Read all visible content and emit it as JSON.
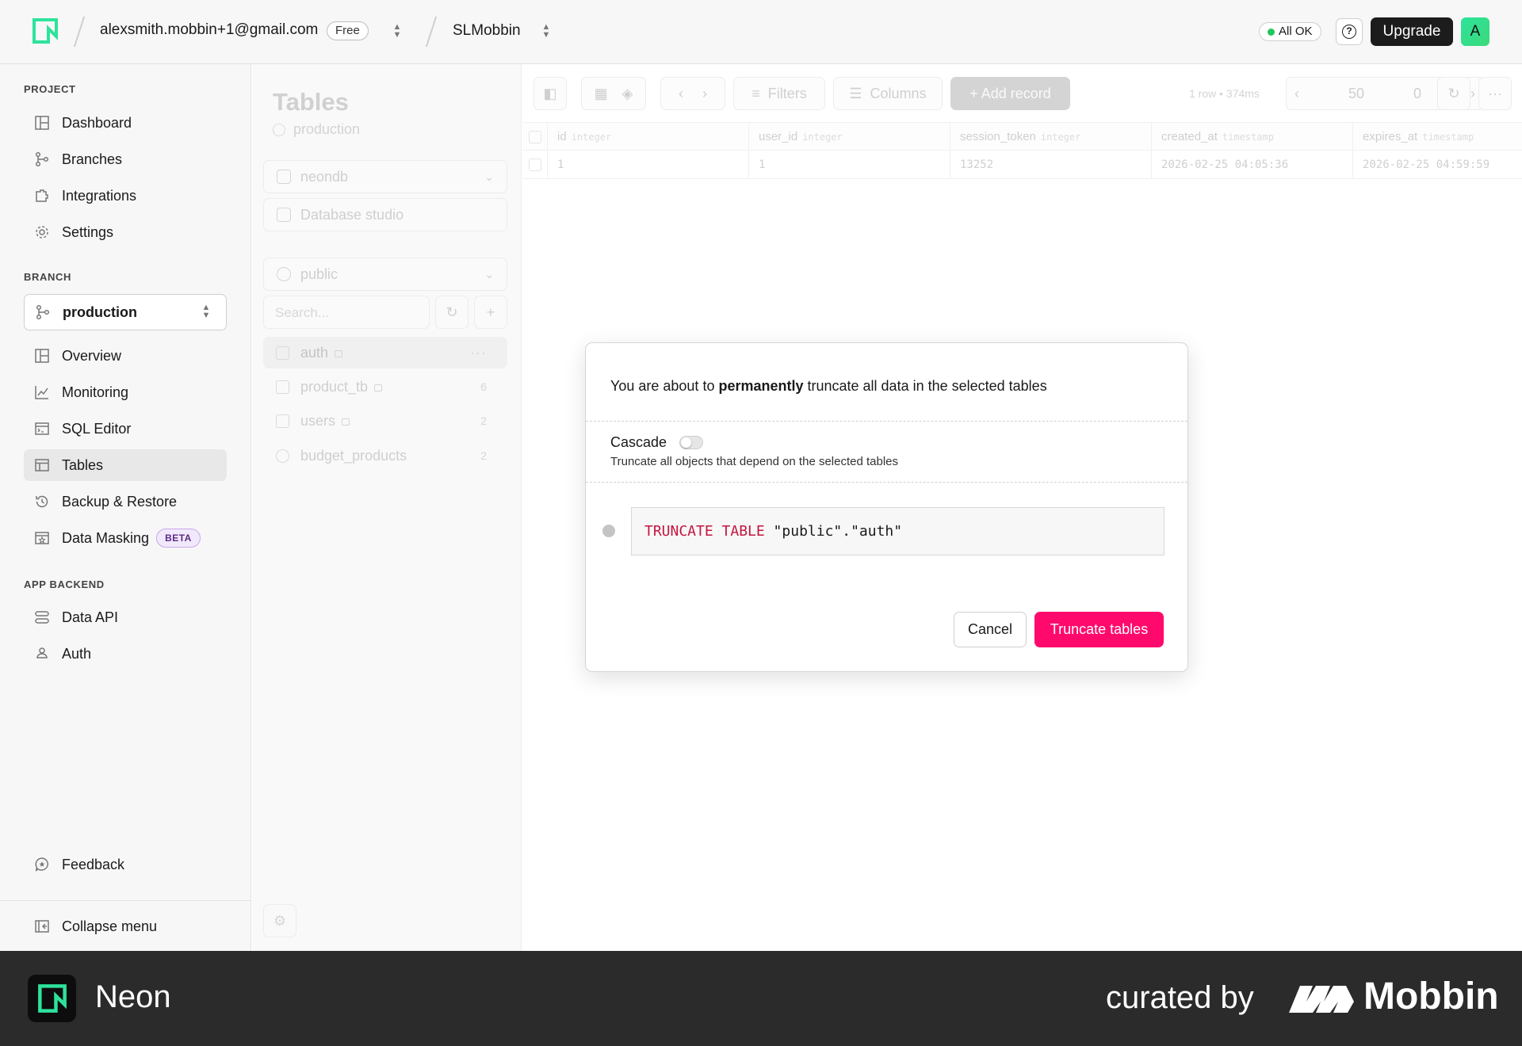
{
  "topbar": {
    "account_email": "alexsmith.mobbin+1@gmail.com",
    "plan": "Free",
    "project": "SLMobbin",
    "status": "All OK",
    "help_symbol": "?",
    "upgrade_label": "Upgrade",
    "avatar_initial": "A"
  },
  "sidebar": {
    "project_section": "PROJECT",
    "project_items": [
      {
        "label": "Dashboard",
        "icon": "dashboard-icon"
      },
      {
        "label": "Branches",
        "icon": "branches-icon"
      },
      {
        "label": "Integrations",
        "icon": "integrations-icon"
      },
      {
        "label": "Settings",
        "icon": "gear-icon"
      }
    ],
    "branch_section": "BRANCH",
    "branch_selected": "production",
    "branch_items": [
      {
        "label": "Overview",
        "icon": "overview-icon"
      },
      {
        "label": "Monitoring",
        "icon": "chart-icon"
      },
      {
        "label": "SQL Editor",
        "icon": "terminal-icon"
      },
      {
        "label": "Tables",
        "icon": "table-icon",
        "active": true
      },
      {
        "label": "Backup & Restore",
        "icon": "history-icon"
      },
      {
        "label": "Data Masking",
        "icon": "masking-icon",
        "badge": "BETA"
      }
    ],
    "backend_section": "APP BACKEND",
    "backend_items": [
      {
        "label": "Data API",
        "icon": "api-icon"
      },
      {
        "label": "Auth",
        "icon": "auth-icon"
      }
    ],
    "feedback_label": "Feedback",
    "collapse_label": "Collapse menu"
  },
  "tables_panel": {
    "title": "Tables",
    "branch": "production",
    "database": "neondb",
    "studio": "Database studio",
    "schema": "public",
    "search_placeholder": "Search...",
    "tables": [
      {
        "name": "auth",
        "locked": true,
        "count": ""
      },
      {
        "name": "product_tb",
        "locked": true,
        "count": "6"
      },
      {
        "name": "users",
        "locked": true,
        "count": "2"
      },
      {
        "name": "budget_products",
        "locked": false,
        "count": "2"
      }
    ]
  },
  "toolbar": {
    "filters_label": "Filters",
    "columns_label": "Columns",
    "add_record_label": "+ Add record",
    "meta": "1 row • 374ms",
    "page_size": "50",
    "offset": "0"
  },
  "grid": {
    "columns": [
      {
        "name": "id",
        "type": "integer"
      },
      {
        "name": "user_id",
        "type": "integer"
      },
      {
        "name": "session_token",
        "type": "integer"
      },
      {
        "name": "created_at",
        "type": "timestamp"
      },
      {
        "name": "expires_at",
        "type": "timestamp"
      }
    ],
    "row": [
      "1",
      "1",
      "13252",
      "2026-02-25 04:05:36",
      "2026-02-25 04:59:59"
    ]
  },
  "modal": {
    "message_pre": "You are about to ",
    "message_bold": "permanently",
    "message_post": " truncate all data in the selected tables",
    "cascade_label": "Cascade",
    "cascade_enabled": false,
    "cascade_desc": "Truncate all objects that depend on the selected tables",
    "sql_keyword": "TRUNCATE TABLE",
    "sql_target": " \"public\".\"auth\"",
    "cancel_label": "Cancel",
    "confirm_label": "Truncate tables"
  },
  "footer": {
    "app_name": "Neon",
    "curated_by": "curated by",
    "brand": "Mobbin"
  },
  "colors": {
    "accent": "#ff0a6c",
    "neon_green": "#2de39c",
    "status_ok": "#22c55e"
  }
}
